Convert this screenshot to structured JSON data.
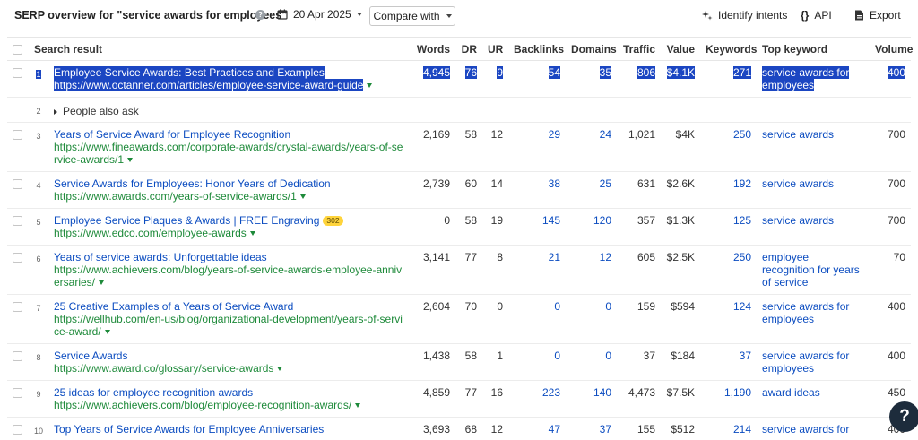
{
  "header": {
    "title": "SERP overview for \"service awards for employees\"",
    "date": "20 Apr 2025",
    "compare_label": "Compare with",
    "identify_label": "Identify intents",
    "api_label": "API",
    "export_label": "Export"
  },
  "columns": {
    "search_result": "Search result",
    "words": "Words",
    "dr": "DR",
    "ur": "UR",
    "backlinks": "Backlinks",
    "domains": "Domains",
    "traffic": "Traffic",
    "value": "Value",
    "keywords": "Keywords",
    "top_keyword": "Top keyword",
    "volume": "Volume"
  },
  "rows": [
    {
      "pos": "1",
      "title": "Employee Service Awards: Best Practices and Examples",
      "url": "https://www.octanner.com/articles/employee-service-award-guide",
      "badge": "",
      "words": "4,945",
      "dr": "76",
      "ur": "9",
      "backlinks": "54",
      "domains": "35",
      "traffic": "806",
      "value": "$4.1K",
      "keywords": "271",
      "top_keyword": "service awards for employees",
      "volume": "400"
    },
    {
      "pos": "2",
      "paa": "People also ask"
    },
    {
      "pos": "3",
      "title": "Years of Service Award for Employee Recognition",
      "url": "https://www.fineawards.com/corporate-awards/crystal-awards/years-of-service-awards/1",
      "badge": "",
      "words": "2,169",
      "dr": "58",
      "ur": "12",
      "backlinks": "29",
      "domains": "24",
      "traffic": "1,021",
      "value": "$4K",
      "keywords": "250",
      "top_keyword": "service awards",
      "volume": "700"
    },
    {
      "pos": "4",
      "title": "Service Awards for Employees: Honor Years of Dedication",
      "url": "https://www.awards.com/years-of-service-awards/1",
      "badge": "",
      "words": "2,739",
      "dr": "60",
      "ur": "14",
      "backlinks": "38",
      "domains": "25",
      "traffic": "631",
      "value": "$2.6K",
      "keywords": "192",
      "top_keyword": "service awards",
      "volume": "700"
    },
    {
      "pos": "5",
      "title": "Employee Service Plaques & Awards | FREE Engraving",
      "url": "https://www.edco.com/employee-awards",
      "badge": "302",
      "words": "0",
      "dr": "58",
      "ur": "19",
      "backlinks": "145",
      "domains": "120",
      "traffic": "357",
      "value": "$1.3K",
      "keywords": "125",
      "top_keyword": "service awards",
      "volume": "700"
    },
    {
      "pos": "6",
      "title": "Years of service awards: Unforgettable ideas",
      "url": "https://www.achievers.com/blog/years-of-service-awards-employee-anniversaries/",
      "badge": "",
      "words": "3,141",
      "dr": "77",
      "ur": "8",
      "backlinks": "21",
      "domains": "12",
      "traffic": "605",
      "value": "$2.5K",
      "keywords": "250",
      "top_keyword": "employee recognition for years of service",
      "volume": "70"
    },
    {
      "pos": "7",
      "title": "25 Creative Examples of a Years of Service Award",
      "url": "https://wellhub.com/en-us/blog/organizational-development/years-of-service-award/",
      "badge": "",
      "words": "2,604",
      "dr": "70",
      "ur": "0",
      "backlinks": "0",
      "domains": "0",
      "traffic": "159",
      "value": "$594",
      "keywords": "124",
      "top_keyword": "service awards for employees",
      "volume": "400"
    },
    {
      "pos": "8",
      "title": "Service Awards",
      "url": "https://www.award.co/glossary/service-awards",
      "badge": "",
      "words": "1,438",
      "dr": "58",
      "ur": "1",
      "backlinks": "0",
      "domains": "0",
      "traffic": "37",
      "value": "$184",
      "keywords": "37",
      "top_keyword": "service awards for employees",
      "volume": "400"
    },
    {
      "pos": "9",
      "title": "25 ideas for employee recognition awards",
      "url": "https://www.achievers.com/blog/employee-recognition-awards/",
      "badge": "",
      "words": "4,859",
      "dr": "77",
      "ur": "16",
      "backlinks": "223",
      "domains": "140",
      "traffic": "4,473",
      "value": "$7.5K",
      "keywords": "1,190",
      "top_keyword": "award ideas",
      "volume": "450"
    },
    {
      "pos": "10",
      "title": "Top Years of Service Awards for Employee Anniversaries",
      "url": "",
      "badge": "",
      "words": "3,693",
      "dr": "68",
      "ur": "12",
      "backlinks": "47",
      "domains": "37",
      "traffic": "155",
      "value": "$512",
      "keywords": "214",
      "top_keyword": "service awards for",
      "volume": "400"
    }
  ],
  "fab_label": "?"
}
